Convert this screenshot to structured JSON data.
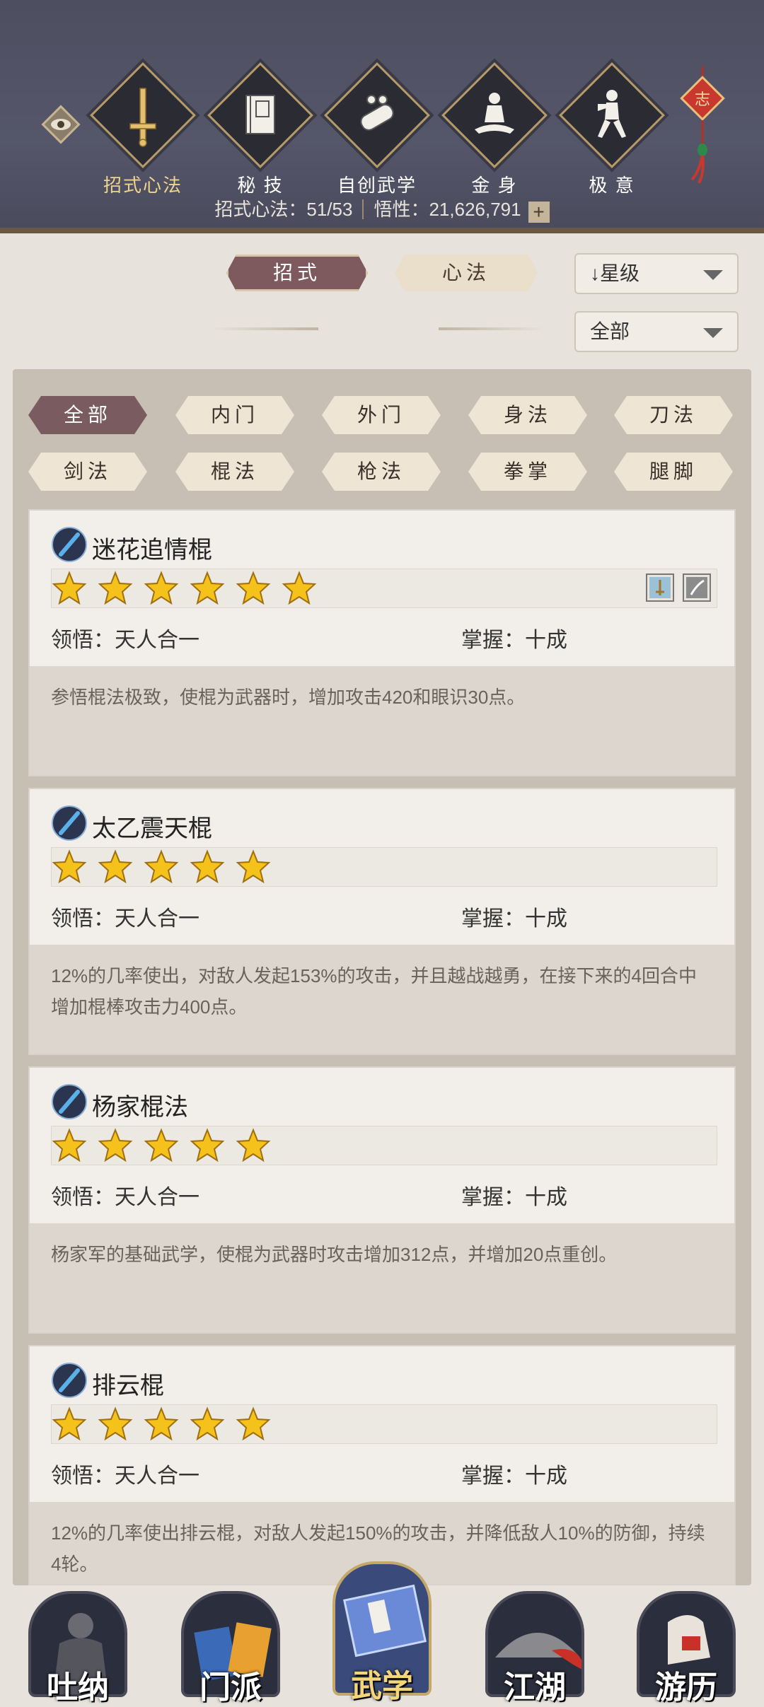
{
  "header": {
    "tabs": [
      {
        "label": "招式心法",
        "icon": "sword-icon",
        "active": true
      },
      {
        "label": "秘 技",
        "icon": "book-icon",
        "active": false
      },
      {
        "label": "自创武学",
        "icon": "scroll-icon",
        "active": false
      },
      {
        "label": "金 身",
        "icon": "meditate-icon",
        "active": false
      },
      {
        "label": "极 意",
        "icon": "martial-pose-icon",
        "active": false
      }
    ],
    "knot_char": "志",
    "stats": {
      "moves_label": "招式心法：51/53",
      "insight_label": "悟性：21,626,791",
      "plus": "+"
    }
  },
  "toggle": {
    "moves": "招式",
    "arts": "心法"
  },
  "sort": {
    "label": "↓星级",
    "filter": "全部"
  },
  "filters": [
    "全部",
    "内门",
    "外门",
    "身法",
    "刀法",
    "剑法",
    "棍法",
    "枪法",
    "拳掌",
    "腿脚"
  ],
  "cards": [
    {
      "name": "迷花追情棍",
      "stars": 6,
      "lingwu": "领悟：天人合一",
      "zhangwo": "掌握：十成",
      "desc": "参悟棍法极致，使棍为武器时，增加攻击420和眼识30点。",
      "badges": true
    },
    {
      "name": "太乙震天棍",
      "stars": 5,
      "lingwu": "领悟：天人合一",
      "zhangwo": "掌握：十成",
      "desc": "12%的几率使出，对敌人发起153%的攻击，并且越战越勇，在接下来的4回合中增加棍棒攻击力400点。",
      "badges": false
    },
    {
      "name": "杨家棍法",
      "stars": 5,
      "lingwu": "领悟：天人合一",
      "zhangwo": "掌握：十成",
      "desc": "杨家军的基础武学，使棍为武器时攻击增加312点，并增加20点重创。",
      "badges": false
    },
    {
      "name": "排云棍",
      "stars": 5,
      "lingwu": "领悟：天人合一",
      "zhangwo": "掌握：十成",
      "desc": "12%的几率使出排云棍，对敌人发起150%的攻击，并降低敌人10%的防御，持续4轮。",
      "badges": false
    }
  ],
  "nav": [
    {
      "label": "吐纳",
      "active": false
    },
    {
      "label": "门派",
      "active": false
    },
    {
      "label": "武学",
      "active": true
    },
    {
      "label": "江湖",
      "active": false
    },
    {
      "label": "游历",
      "active": false
    }
  ]
}
